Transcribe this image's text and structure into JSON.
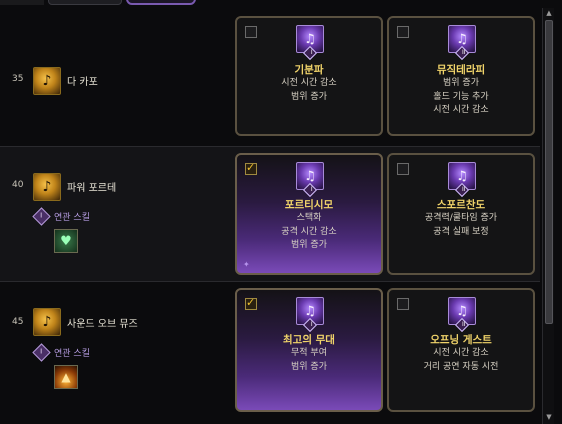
{
  "rows": [
    {
      "level": "35",
      "skill_name": "다 카포",
      "related_label": null,
      "cards": [
        {
          "name": "기분파",
          "roman": "I",
          "selected": false,
          "desc": [
            "시전 시간 감소",
            "범위 증가"
          ]
        },
        {
          "name": "뮤직테라피",
          "roman": "II",
          "selected": false,
          "desc": [
            "범위 증가",
            "홀드 기능 추가",
            "시전 시간 감소"
          ]
        }
      ]
    },
    {
      "level": "40",
      "skill_name": "파워 포르테",
      "related_label": "연관 스킬",
      "cards": [
        {
          "name": "포르티시모",
          "roman": "I",
          "selected": true,
          "desc": [
            "스택화",
            "공격 시간 감소",
            "범위 증가"
          ]
        },
        {
          "name": "스포르찬도",
          "roman": "II",
          "selected": false,
          "desc": [
            "공격력/쿨타임 증가",
            "공격 실패 보정"
          ]
        }
      ]
    },
    {
      "level": "45",
      "skill_name": "사운드 오브 뮤즈",
      "related_label": "연관 스킬",
      "cards": [
        {
          "name": "최고의 무대",
          "roman": "I",
          "selected": true,
          "desc": [
            "무적 부여",
            "범위 증가"
          ]
        },
        {
          "name": "오프닝 게스트",
          "roman": "II",
          "selected": false,
          "desc": [
            "시전 시간 감소",
            "거리 공연 자동 시전"
          ]
        }
      ]
    }
  ],
  "icons": {
    "skill": "music-note-icon",
    "tripod": "tripod-rune-icon",
    "related_badge": "diamond-badge-icon",
    "related_skill_2": "heart-skill-icon",
    "related_skill_3": "stage-light-icon"
  },
  "colors": {
    "title_gold": "#f1d46a",
    "related_purple": "#b59ce0",
    "selected_glow": "#7a4ab8"
  }
}
